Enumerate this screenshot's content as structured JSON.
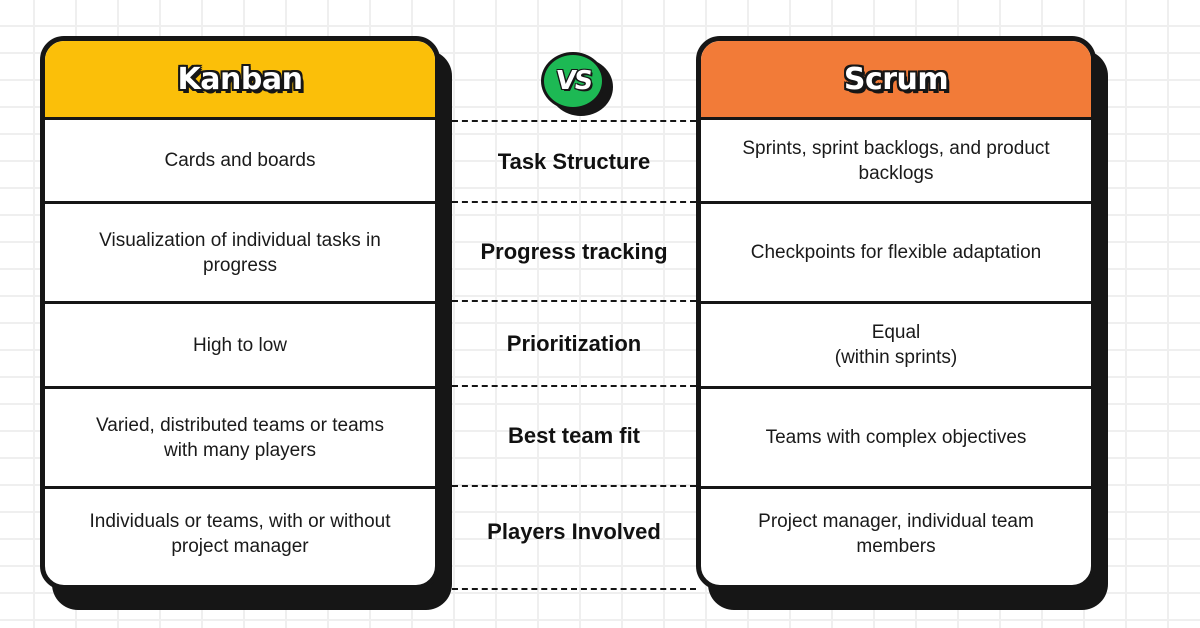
{
  "colors": {
    "kanban_header": "#fbbf09",
    "scrum_header": "#f27b38",
    "vs_badge": "#1db954",
    "outline": "#161616"
  },
  "kanban": {
    "title": "Kanban",
    "rows": [
      "Cards and boards",
      "Visualization of individual tasks in progress",
      "High to low",
      "Varied, distributed teams or teams with many players",
      "Individuals or teams, with or without project manager"
    ]
  },
  "vs_badge": {
    "label": "VS",
    "icon": "vs-badge-icon"
  },
  "criteria": [
    "Task Structure",
    "Progress tracking",
    "Prioritization",
    "Best team fit",
    "Players Involved"
  ],
  "scrum": {
    "title": "Scrum",
    "rows": [
      "Sprints, sprint backlogs, and product backlogs",
      "Checkpoints for flexible adaptation",
      "Equal\n(within sprints)",
      "Teams with complex objectives",
      "Project manager, individual team members"
    ]
  }
}
